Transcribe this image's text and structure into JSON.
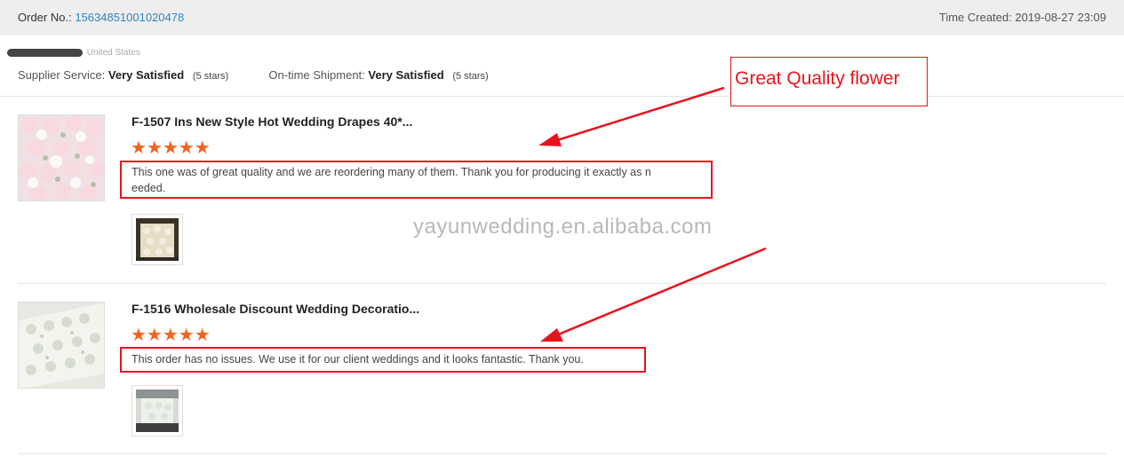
{
  "header": {
    "order_label": "Order No.:",
    "order_number": "15634851001020478",
    "time_created": "Time Created: 2019-08-27 23:09"
  },
  "buyer": {
    "country": "United States"
  },
  "ratings": {
    "supplier_label": "Supplier Service:",
    "supplier_value": "Very Satisfied",
    "supplier_stars": "(5 stars)",
    "shipment_label": "On-time Shipment:",
    "shipment_value": "Very Satisfied",
    "shipment_stars": "(5 stars)"
  },
  "items": [
    {
      "title": "F-1507 Ins New Style Hot Wedding Drapes 40*...",
      "stars": "★★★★★",
      "rating": 5,
      "review_line1": "This one was of great quality and we are reordering many of them. Thank you for producing it exactly as n",
      "review_line2": "eeded."
    },
    {
      "title": "F-1516 Wholesale Discount Wedding Decoratio...",
      "stars": "★★★★★",
      "rating": 5,
      "review_line1": "This order has no issues. We use it for our client weddings and it looks fantastic. Thank you."
    }
  ],
  "watermark": "yayunwedding.en.alibaba.com",
  "annotation": "Great Quality flower",
  "colors": {
    "accent_red": "#e8141d",
    "star_orange": "#f3631d",
    "link_blue": "#2e86c9"
  }
}
